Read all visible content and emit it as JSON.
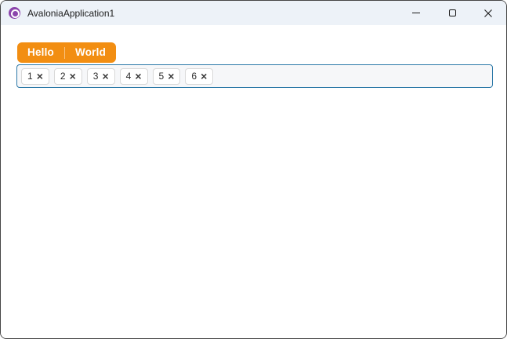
{
  "window": {
    "title": "AvaloniaApplication1",
    "controls": {
      "minimize": "minimize",
      "maximize": "maximize",
      "close": "close"
    }
  },
  "colors": {
    "accent_orange": "#F28E12",
    "tagbox_focus_border": "#2C79A8",
    "titlebar_bg": "#EDF2F8",
    "logo_purple": "#8B44AC",
    "chip_border": "#D8D8D8",
    "chip_bg": "#FFFFFF",
    "tagbox_bg": "#F6F7F9"
  },
  "tabstrip": {
    "items": [
      {
        "label": "Hello"
      },
      {
        "label": "World"
      }
    ]
  },
  "tagbox": {
    "close_glyph": "×",
    "items": [
      {
        "label": "1"
      },
      {
        "label": "2"
      },
      {
        "label": "3"
      },
      {
        "label": "4"
      },
      {
        "label": "5"
      },
      {
        "label": "6"
      }
    ]
  }
}
